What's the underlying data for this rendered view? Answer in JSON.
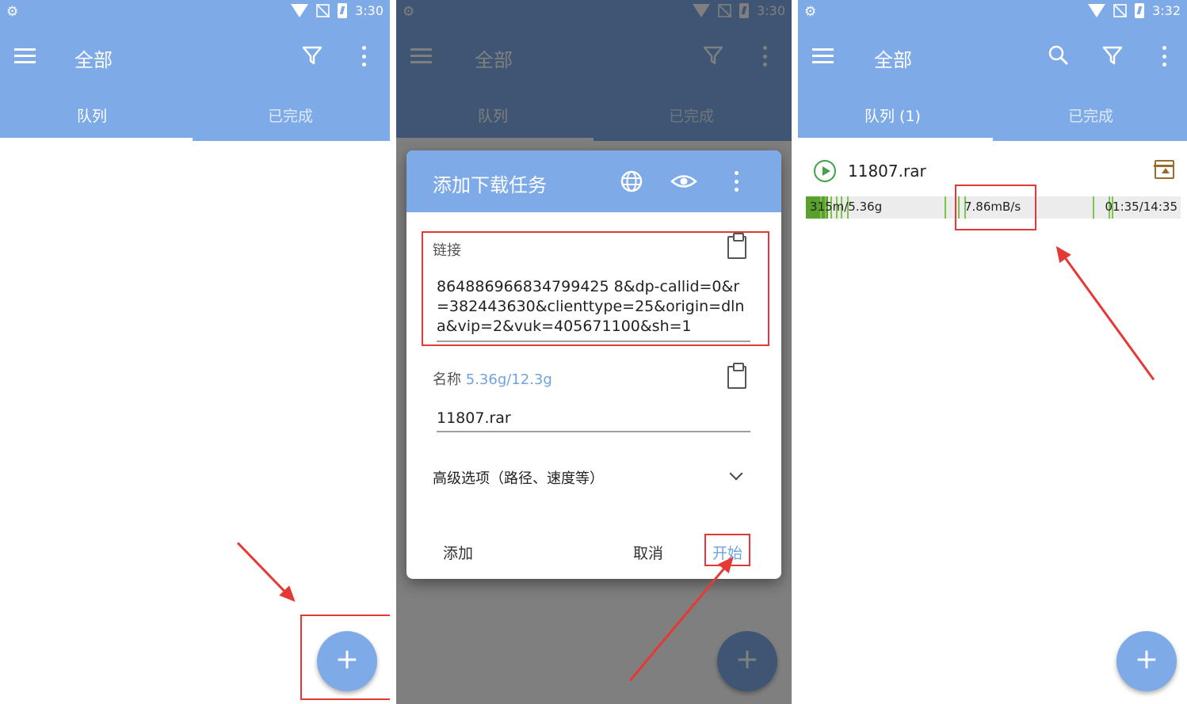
{
  "status": {
    "time1": "3:30",
    "time2": "3:30",
    "time3": "3:32"
  },
  "toolbar": {
    "title": "全部"
  },
  "tabs": {
    "queue": "队列",
    "queue_count": "队列 (1)",
    "done": "已完成"
  },
  "fab": {
    "label": "+"
  },
  "dialog": {
    "title": "添加下载任务",
    "link_label": "链接",
    "link_value": "864886966834799425 8&dp-callid=0&r=382443630&clienttype=25&origin=dlna&vip=2&vuk=405671100&sh=1",
    "name_label": "名称",
    "name_size": "5.36g/12.3g",
    "name_value": "11807.rar",
    "advanced": "高级选项（路径、速度等）",
    "btn_add": "添加",
    "btn_cancel": "取消",
    "btn_start": "开始"
  },
  "task": {
    "name": "11807.rar",
    "size_progress": "315m/5.36g",
    "speed": "7.86mB/s",
    "time": "01:35/14:35",
    "progress_fraction": 0.059
  },
  "colors": {
    "accent": "#7eaae8",
    "highlight": "#e53935",
    "progress": "#5aa02c"
  }
}
